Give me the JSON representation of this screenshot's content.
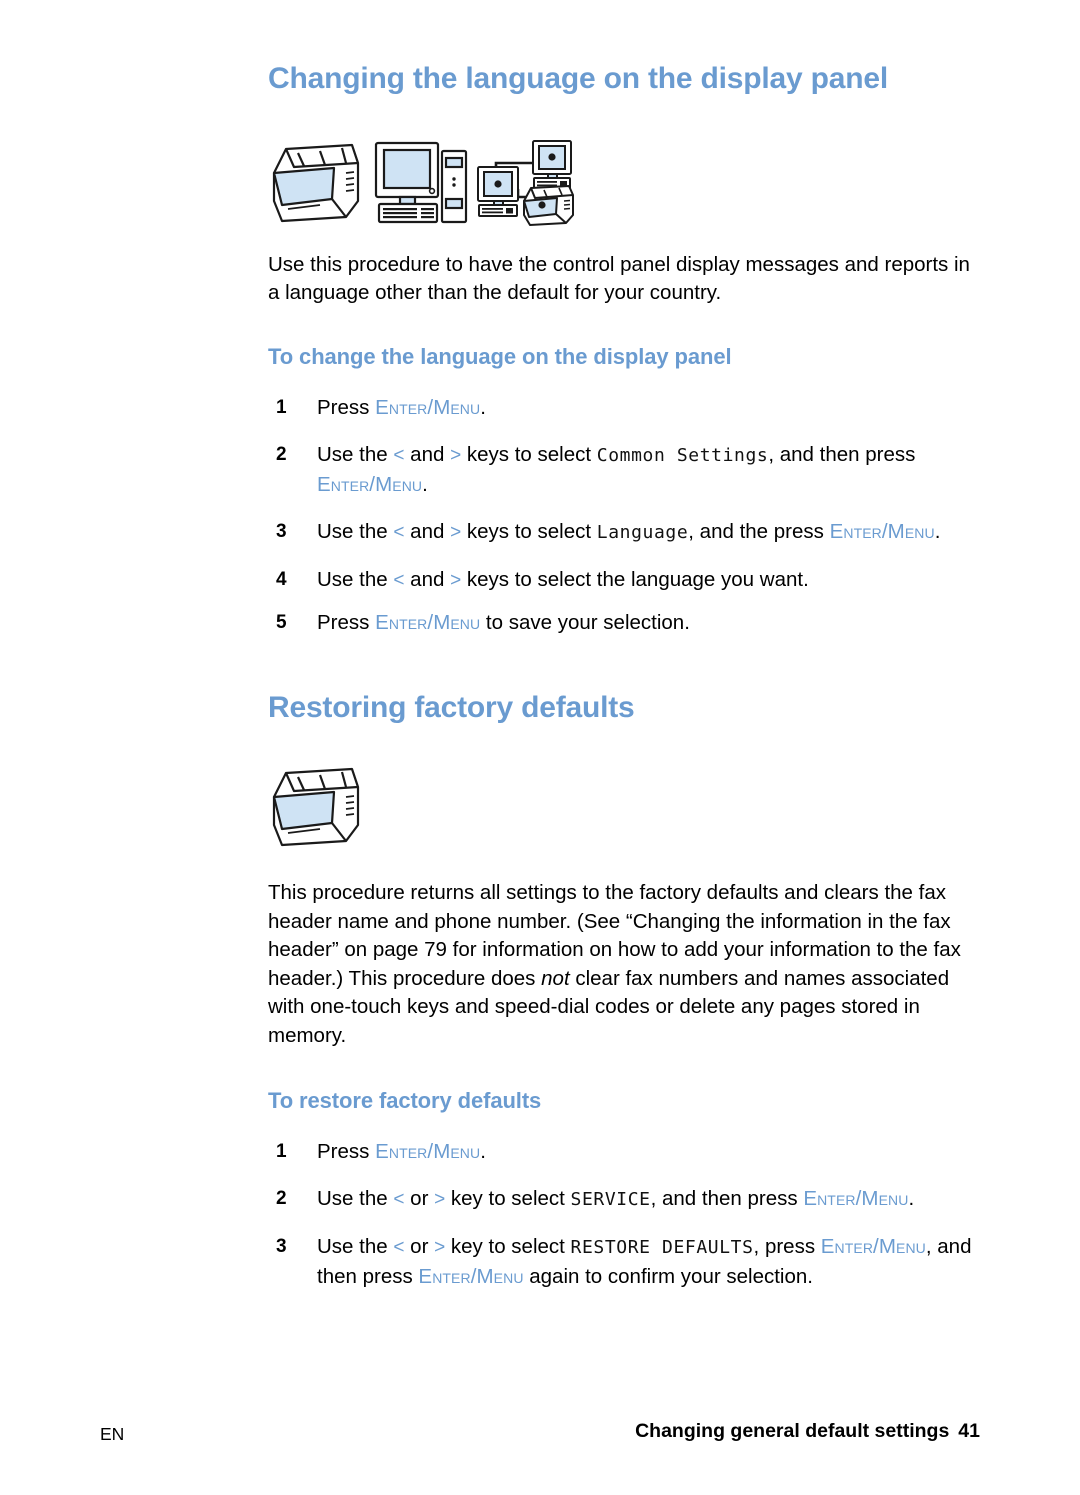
{
  "document": {
    "language_code": "EN",
    "footer_breadcrumb": "Changing general default settings",
    "page_number": "41"
  },
  "colors": {
    "heading_blue": "#6a9bd0",
    "key_blue": "#6a9bd0",
    "body_black": "#000000",
    "icon_fill_blue": "#cfe3f4"
  },
  "sections": [
    {
      "id": "changing-language",
      "title": "Changing the language on the display panel",
      "icons": [
        "printer-icon",
        "computer-icon",
        "network-printer-icon"
      ],
      "intro": "Use this procedure to have the control panel display messages and reports in a language other than the default for your country.",
      "subheading": "To change the language on the display panel",
      "steps": [
        {
          "number": "1",
          "parts": [
            {
              "type": "text",
              "value": "Press "
            },
            {
              "type": "key",
              "value": "Enter/Menu"
            },
            {
              "type": "text",
              "value": "."
            }
          ]
        },
        {
          "number": "2",
          "parts": [
            {
              "type": "text",
              "value": "Use the "
            },
            {
              "type": "arrow",
              "value": "<"
            },
            {
              "type": "text",
              "value": " and "
            },
            {
              "type": "arrow",
              "value": ">"
            },
            {
              "type": "text",
              "value": " keys to select "
            },
            {
              "type": "lcd",
              "value": "Common Settings"
            },
            {
              "type": "text",
              "value": ", and then press "
            },
            {
              "type": "key",
              "value": "Enter/Menu"
            },
            {
              "type": "text",
              "value": "."
            }
          ]
        },
        {
          "number": "3",
          "parts": [
            {
              "type": "text",
              "value": "Use the "
            },
            {
              "type": "arrow",
              "value": "<"
            },
            {
              "type": "text",
              "value": " and "
            },
            {
              "type": "arrow",
              "value": ">"
            },
            {
              "type": "text",
              "value": " keys to select "
            },
            {
              "type": "lcd",
              "value": "Language"
            },
            {
              "type": "text",
              "value": ", and the press "
            },
            {
              "type": "key",
              "value": "Enter/Menu"
            },
            {
              "type": "text",
              "value": "."
            }
          ]
        },
        {
          "number": "4",
          "parts": [
            {
              "type": "text",
              "value": "Use the "
            },
            {
              "type": "arrow",
              "value": "<"
            },
            {
              "type": "text",
              "value": " and "
            },
            {
              "type": "arrow",
              "value": ">"
            },
            {
              "type": "text",
              "value": " keys to select the language you want."
            }
          ]
        },
        {
          "number": "5",
          "parts": [
            {
              "type": "text",
              "value": "Press "
            },
            {
              "type": "key",
              "value": "Enter/Menu"
            },
            {
              "type": "text",
              "value": " to save your selection."
            }
          ]
        }
      ]
    },
    {
      "id": "restoring-defaults",
      "title": "Restoring factory defaults",
      "icons": [
        "printer-icon"
      ],
      "intro_parts": [
        {
          "type": "text",
          "value": "This procedure returns all settings to the factory defaults and clears the fax header name and phone number. (See “Changing the information in the fax header” on page 79 for information on how to add your information to the fax header.) This procedure does "
        },
        {
          "type": "italic",
          "value": "not"
        },
        {
          "type": "text",
          "value": " clear fax numbers and names associated with one-touch keys and speed-dial codes or delete any pages stored in memory."
        }
      ],
      "subheading": "To restore factory defaults",
      "steps": [
        {
          "number": "1",
          "parts": [
            {
              "type": "text",
              "value": "Press "
            },
            {
              "type": "key",
              "value": "Enter/Menu"
            },
            {
              "type": "text",
              "value": "."
            }
          ]
        },
        {
          "number": "2",
          "parts": [
            {
              "type": "text",
              "value": "Use the "
            },
            {
              "type": "arrow",
              "value": "<"
            },
            {
              "type": "text",
              "value": " or "
            },
            {
              "type": "arrow",
              "value": ">"
            },
            {
              "type": "text",
              "value": " key to select "
            },
            {
              "type": "lcd",
              "value": "SERVICE"
            },
            {
              "type": "text",
              "value": ", and then press "
            },
            {
              "type": "key",
              "value": "Enter/Menu"
            },
            {
              "type": "text",
              "value": "."
            }
          ]
        },
        {
          "number": "3",
          "parts": [
            {
              "type": "text",
              "value": "Use the "
            },
            {
              "type": "arrow",
              "value": "<"
            },
            {
              "type": "text",
              "value": " or "
            },
            {
              "type": "arrow",
              "value": ">"
            },
            {
              "type": "text",
              "value": " key to select "
            },
            {
              "type": "lcd",
              "value": "RESTORE DEFAULTS"
            },
            {
              "type": "text",
              "value": ", press "
            },
            {
              "type": "key",
              "value": "Enter/Menu"
            },
            {
              "type": "text",
              "value": ", and then press "
            },
            {
              "type": "key",
              "value": "Enter/Menu"
            },
            {
              "type": "text",
              "value": " again to confirm your selection."
            }
          ]
        }
      ]
    }
  ]
}
